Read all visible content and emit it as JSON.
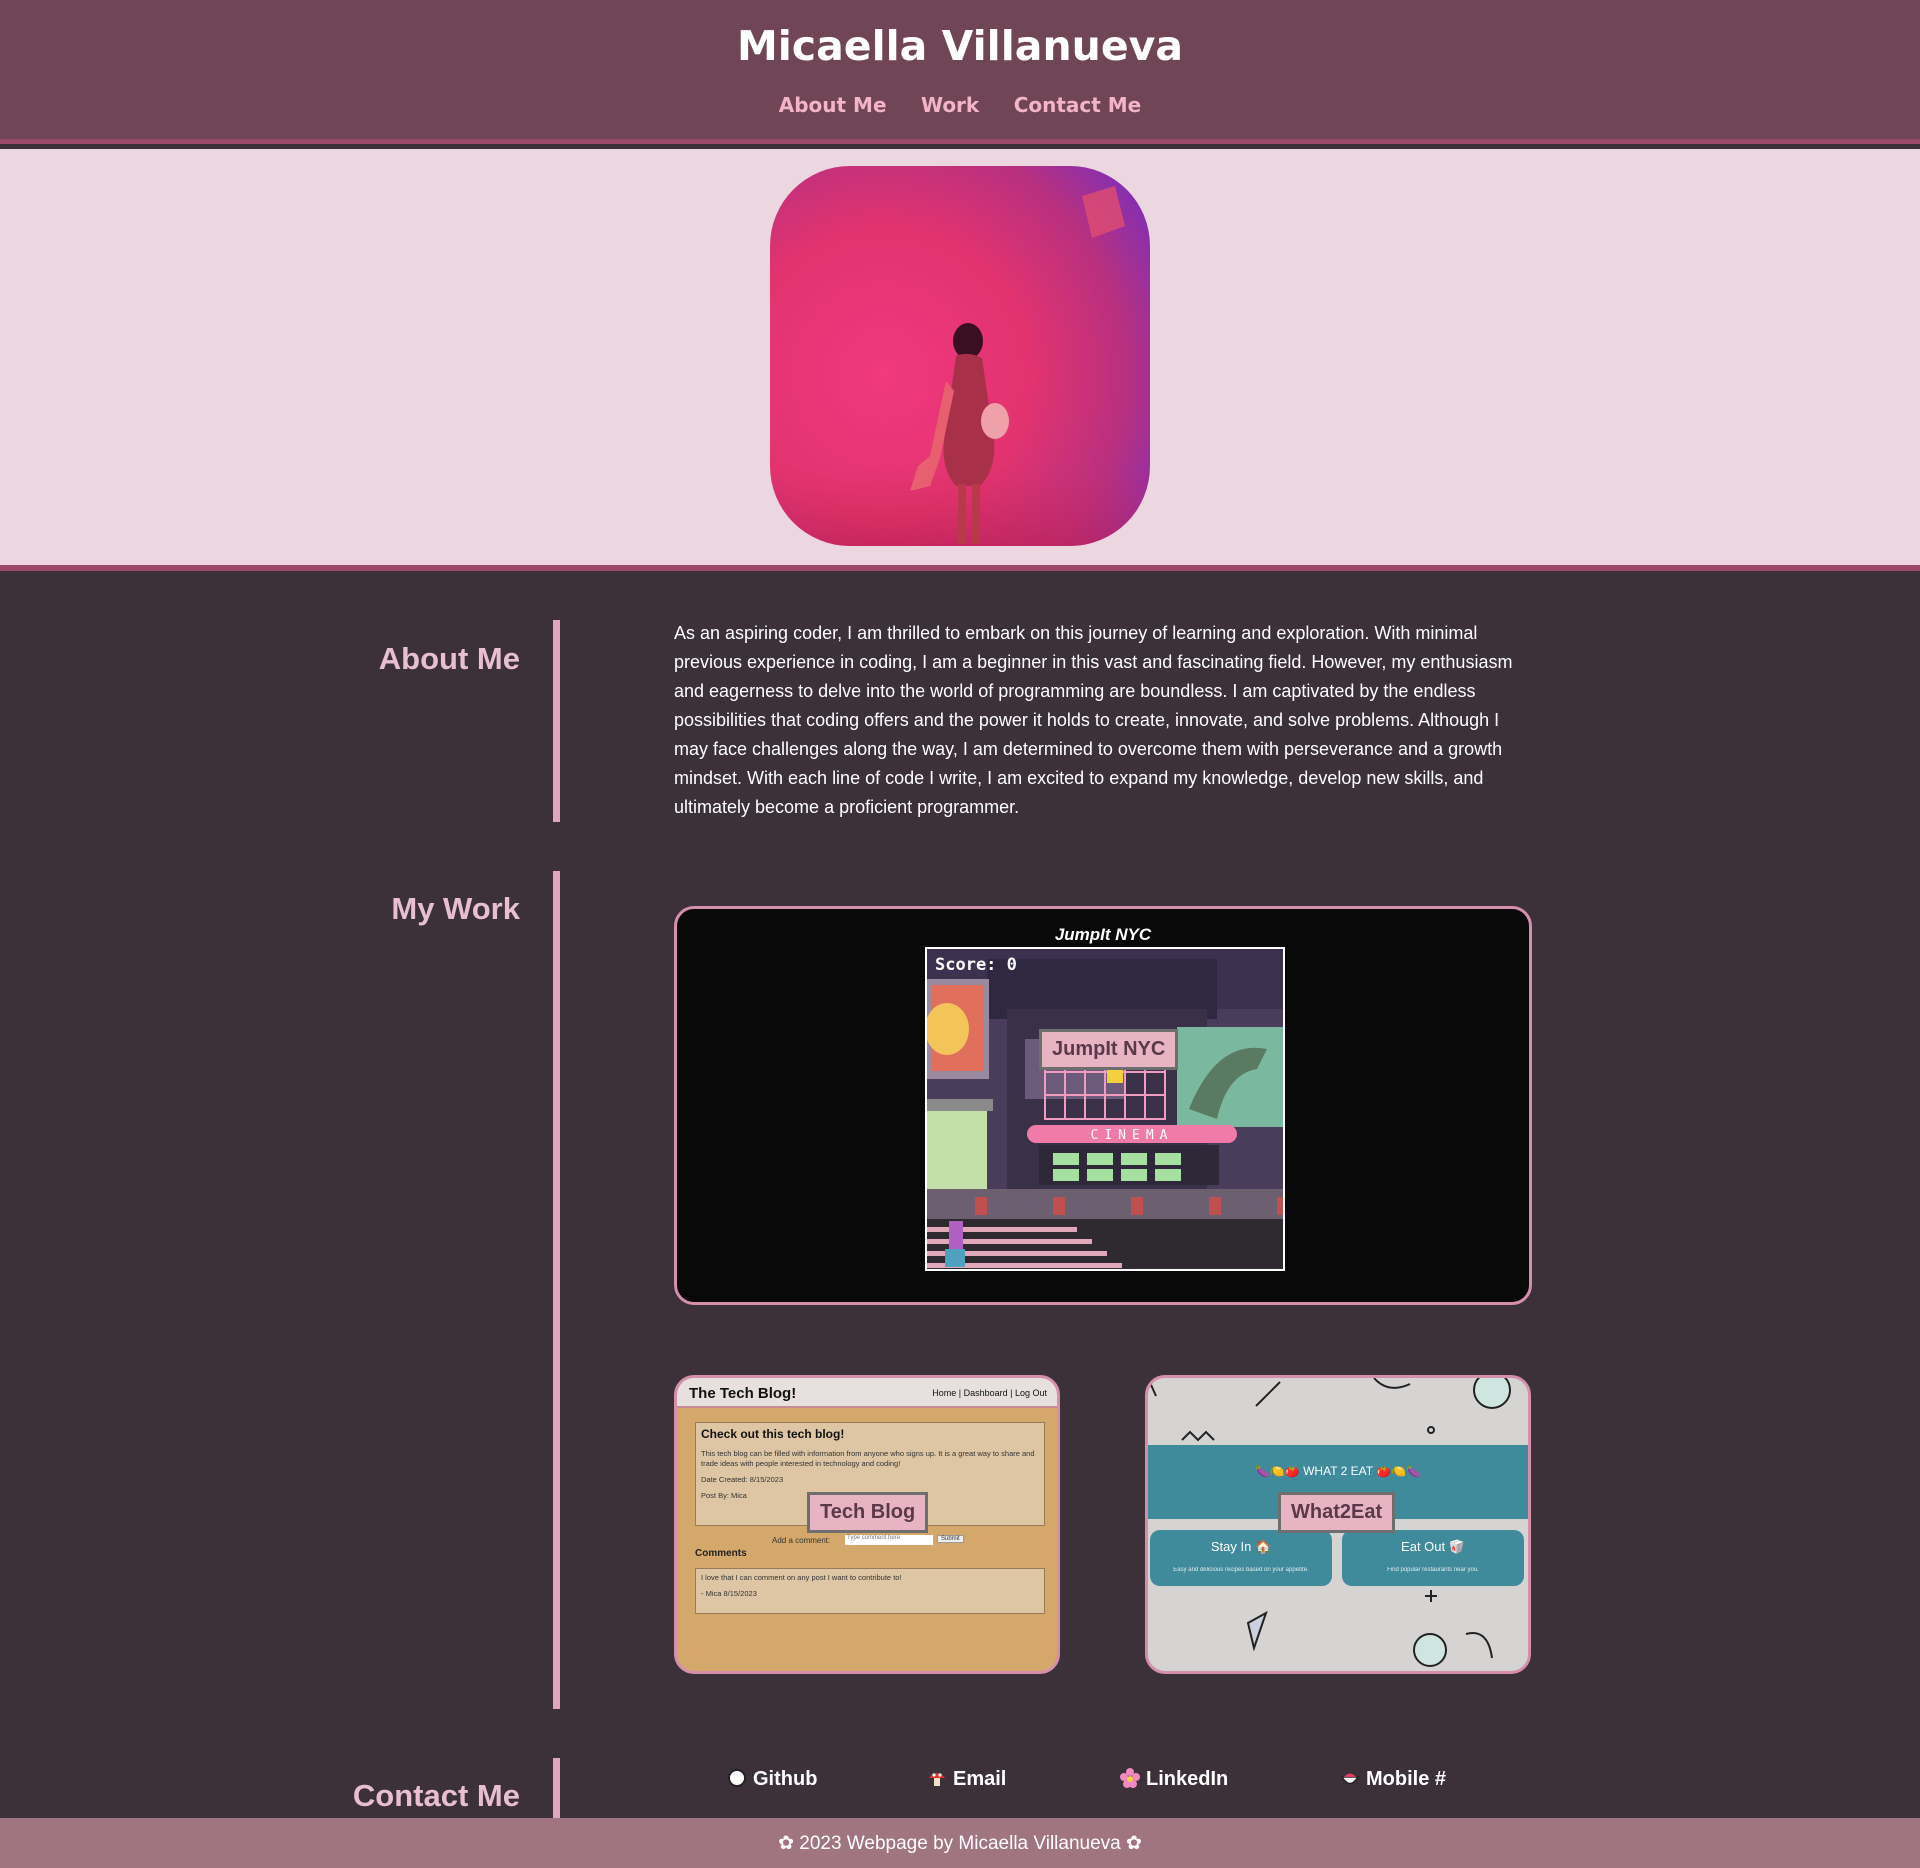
{
  "header": {
    "title": "Micaella Villanueva",
    "nav": [
      "About Me",
      "Work",
      "Contact Me"
    ]
  },
  "about": {
    "heading": "About Me",
    "text": "As an aspiring coder, I am thrilled to embark on this journey of learning and exploration. With minimal previous experience in coding, I am a beginner in this vast and fascinating field. However, my enthusiasm and eagerness to delve into the world of programming are boundless. I am captivated by the endless possibilities that coding offers and the power it holds to create, innovate, and solve problems. Although I may face challenges along the way, I am determined to overcome them with perseverance and a growth mindset. With each line of code I write, I am excited to expand my knowledge, develop new skills, and ultimately become a proficient programmer."
  },
  "work": {
    "heading": "My Work",
    "main_project": {
      "title": "JumpIt NYC",
      "score": "Score: 0",
      "label": "JumpIt NYC",
      "sign": "CINEMA"
    },
    "blog_project": {
      "label": "Tech Blog",
      "site_title": "The Tech Blog!",
      "nav": "Home | Dashboard | Log Out",
      "post_title": "Check out this tech blog!",
      "post_body": "This tech blog can be filled with information from anyone who signs up. It is a great way to share and trade ideas with people interested in technology and coding!",
      "post_date": "Date Created: 8/15/2023",
      "post_by": "Post By: Mica",
      "add_comment": "Add a comment:",
      "comment_placeholder": "Type comment here",
      "submit": "Submit",
      "comments_label": "Comments",
      "comment_text": "I love that I can comment on any post I want to contribute to!",
      "comment_by": "- Mica 8/15/2023"
    },
    "eat_project": {
      "label": "What2Eat",
      "band_title": "🍆🍋🍅 WHAT 2 EAT 🍅🍋🍆",
      "stay_in": "Stay In 🏠",
      "stay_in_sub": "Easy and delicious recipes based on your appetite.",
      "eat_out": "Eat Out 🥡",
      "eat_out_sub": "Find popular restaurants near you."
    }
  },
  "contact": {
    "heading": "Contact Me",
    "links": [
      {
        "label": "Github",
        "icon": "github-circle-icon"
      },
      {
        "label": "Email",
        "icon": "mushroom-icon"
      },
      {
        "label": "LinkedIn",
        "icon": "flower-icon"
      },
      {
        "label": "Mobile #",
        "icon": "bowl-icon"
      }
    ]
  },
  "footer": {
    "text": "✿ 2023 Webpage by Micaella Villanueva ✿"
  },
  "colors": {
    "header_bg": "#704657",
    "hero_bg": "#ecd6e0",
    "page_bg": "#3c3039",
    "accent_pink": "#e0a6bb",
    "footer_bg": "#a07480"
  }
}
